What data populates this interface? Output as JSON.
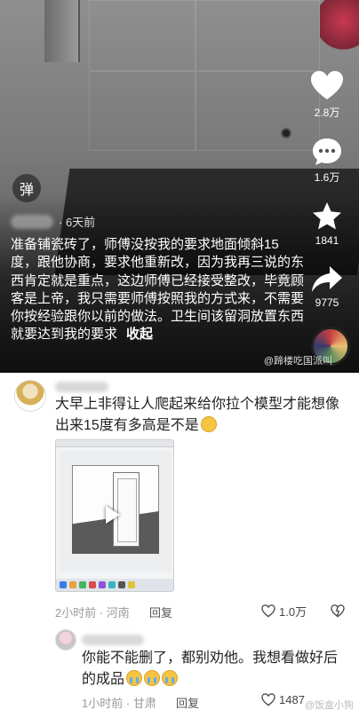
{
  "video": {
    "danmu_label": "弹",
    "author_time": "· 6天前",
    "caption": "准备铺瓷砖了，师傅没按我的要求地面倾斜15度，跟他协商，要求他重新改，因为我再三说的东西肯定就是重点，这边师傅已经接受整改，毕竟顾客是上帝，我只需要师傅按照我的方式来，不需要你按经验跟你以前的做法。卫生间该留洞放置东西就要达到我的要求",
    "collapse_label": "收起",
    "actions": {
      "like_count": "2.8万",
      "comment_count": "1.6万",
      "favorite_count": "1841",
      "share_count": "9775"
    },
    "watermark": "@蹄楼吃国派叫"
  },
  "comments": [
    {
      "text": "大早上非得让人爬起来给你拉个模型才能想像出来15度有多高是不是",
      "emoji": "grin-emoji",
      "meta": "2小时前 · 河南",
      "reply_label": "回复",
      "like_count": "1.0万"
    },
    {
      "text": "你能不能删了，都别劝他。我想看做好后的成品",
      "emoji": "crying-emoji",
      "meta": "1小时前 · 甘肃",
      "reply_label": "回复",
      "like_count": "1487"
    }
  ],
  "footer_watermark": "@饭盒小狗",
  "colors": {
    "video_text": "#ffffff",
    "meta_gray": "#999999",
    "emoji_yellow": "#f6c445"
  }
}
